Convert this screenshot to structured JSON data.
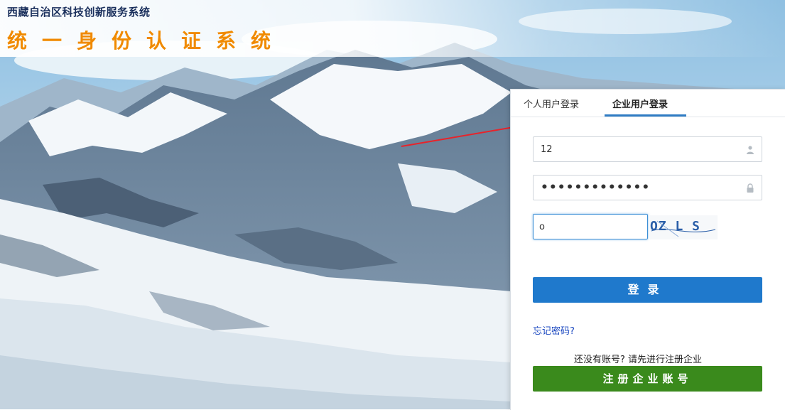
{
  "header": {
    "system_name": "西藏自治区科技创新服务系统",
    "portal_title": "统一身份认证系统"
  },
  "login": {
    "tabs": [
      {
        "label": "个人用户登录",
        "active": false
      },
      {
        "label": "企业用户登录",
        "active": true
      }
    ],
    "username_value": "12",
    "password_value": "•••••••••••••",
    "captcha_value": "o",
    "captcha_image_text": "OZ L S",
    "login_button": "登录",
    "forgot_password": "忘记密码?",
    "register_hint": "还没有账号? 请先进行注册企业",
    "register_button": "注册企业账号"
  },
  "icons": {
    "user": "user-icon",
    "lock": "lock-icon"
  },
  "colors": {
    "title_orange": "#f08a00",
    "system_name_navy": "#1a2f5c",
    "login_blue": "#1f79cc",
    "register_green": "#3a8a1c",
    "tab_underline": "#2f7cc4",
    "annotation_arrow": "#e8232a"
  }
}
